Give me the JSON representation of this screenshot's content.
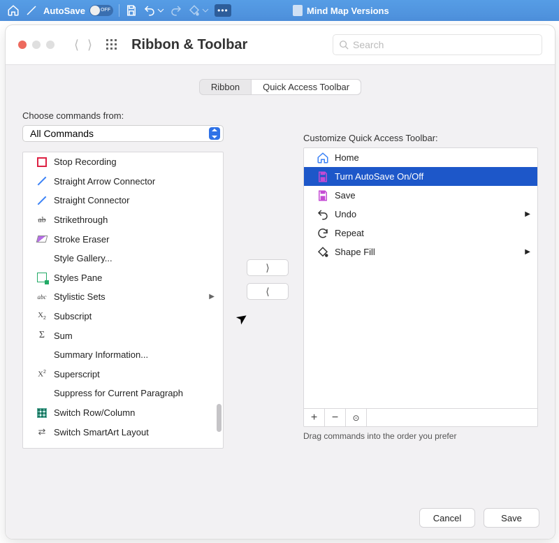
{
  "appbar": {
    "autosave_label": "AutoSave",
    "autosave_state": "OFF",
    "doc_title": "Mind Map Versions"
  },
  "sheet": {
    "title": "Ribbon & Toolbar",
    "search_placeholder": "Search",
    "tabs": {
      "ribbon": "Ribbon",
      "qat": "Quick Access Toolbar"
    }
  },
  "left": {
    "label": "Choose commands from:",
    "dropdown_value": "All Commands",
    "items": [
      {
        "label": "Stop Recording",
        "icon": "square"
      },
      {
        "label": "Straight Arrow Connector",
        "icon": "line"
      },
      {
        "label": "Straight Connector",
        "icon": "line"
      },
      {
        "label": "Strikethrough",
        "icon": "strike"
      },
      {
        "label": "Stroke Eraser",
        "icon": "eraser"
      },
      {
        "label": "Style Gallery...",
        "icon": "blank"
      },
      {
        "label": "Styles Pane",
        "icon": "stylespane"
      },
      {
        "label": "Stylistic Sets",
        "icon": "abc",
        "submenu": true
      },
      {
        "label": "Subscript",
        "icon": "sub"
      },
      {
        "label": "Sum",
        "icon": "sigma"
      },
      {
        "label": "Summary Information...",
        "icon": "blank"
      },
      {
        "label": "Superscript",
        "icon": "sup"
      },
      {
        "label": "Suppress for Current Paragraph",
        "icon": "blank"
      },
      {
        "label": "Switch Row/Column",
        "icon": "gridblue"
      },
      {
        "label": "Switch SmartArt Layout",
        "icon": "swap"
      }
    ]
  },
  "right": {
    "label": "Customize Quick Access Toolbar:",
    "items": [
      {
        "label": "Home",
        "icon": "home"
      },
      {
        "label": "Turn AutoSave On/Off",
        "icon": "save-purple",
        "selected": true
      },
      {
        "label": "Save",
        "icon": "save-purple"
      },
      {
        "label": "Undo",
        "icon": "undo",
        "submenu": true
      },
      {
        "label": "Repeat",
        "icon": "repeat"
      },
      {
        "label": "Shape Fill",
        "icon": "fill",
        "submenu": true
      }
    ],
    "hint": "Drag commands into the order you prefer"
  },
  "footer": {
    "cancel": "Cancel",
    "save": "Save"
  }
}
